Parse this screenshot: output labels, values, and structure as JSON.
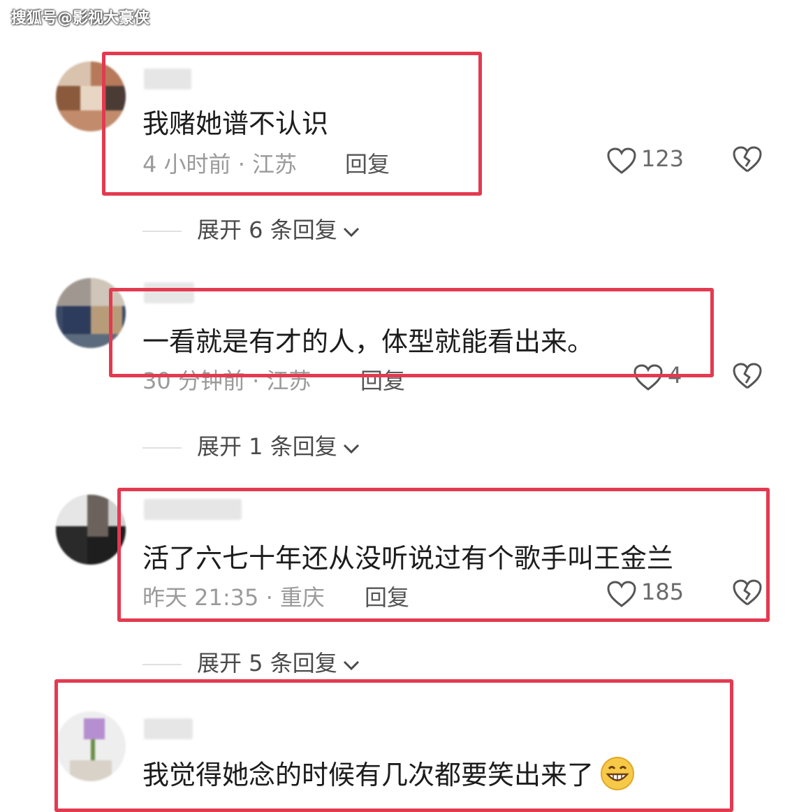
{
  "watermark": "搜狐号@影视大豪侠",
  "colors": {
    "highlight": "#e33a50",
    "meta": "#9a9a9a",
    "text": "#1c1c1c"
  },
  "comments": [
    {
      "text": "我赌她谱不认识",
      "meta": "4 小时前 · 江苏",
      "reply_label": "回复",
      "likes": "123",
      "expand": "展开 6 条回复"
    },
    {
      "text": "一看就是有才的人，体型就能看出来。",
      "meta": "30 分钟前 · 江苏",
      "reply_label": "回复",
      "likes": "4",
      "expand": "展开 1 条回复"
    },
    {
      "text": "活了六七十年还从没听说过有个歌手叫王金兰",
      "meta": "昨天 21:35 · 重庆",
      "reply_label": "回复",
      "likes": "185",
      "expand": "展开 5 条回复"
    },
    {
      "text": "我觉得她念的时候有几次都要笑出来了"
    }
  ]
}
